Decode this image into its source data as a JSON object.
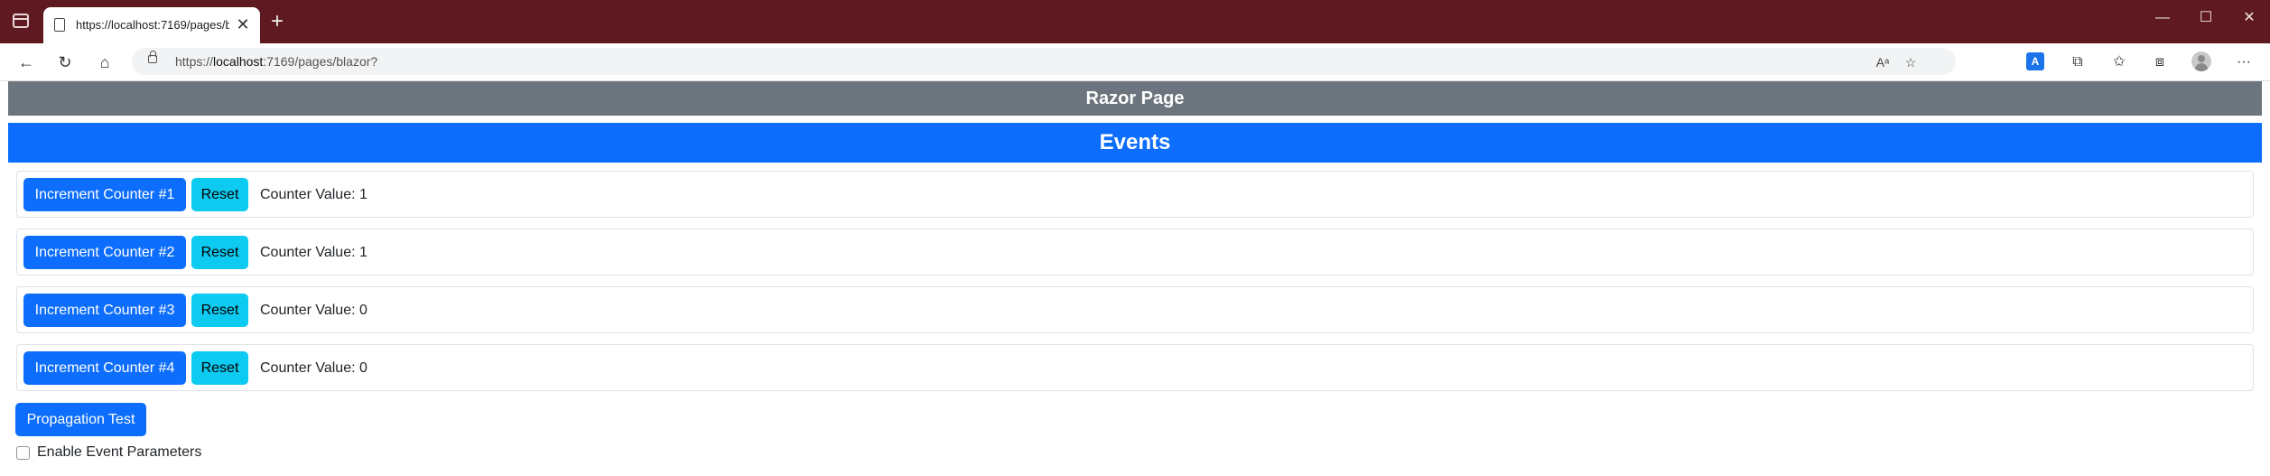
{
  "browser": {
    "tab_title": "https://localhost:7169/pages/blazor?",
    "tab_close_glyph": "✕",
    "new_tab_glyph": "+",
    "url_host_prefix": "https://",
    "url_host": "localhost",
    "url_rest": ":7169/pages/blazor?",
    "window_controls": {
      "minimize": "—",
      "maximize": "☐",
      "close": "✕"
    },
    "nav_glyphs": {
      "back": "←",
      "refresh": "↻",
      "home": "⌂"
    },
    "toolbar_glyphs": {
      "read_aloud": "Aᵃ",
      "favorite": "☆",
      "translate": "A",
      "extensions": "⧉",
      "favorites_bar": "✩",
      "collections": "⧈",
      "more": "···"
    },
    "colors": {
      "title_bar": "#5e1a20",
      "primary": "#0d6efd",
      "info": "#0dcaf0",
      "secondary": "#6c757d"
    }
  },
  "page": {
    "header": "Razor Page",
    "section_title": "Events",
    "counters": [
      {
        "button": "Increment Counter #1",
        "reset": "Reset",
        "value_text": "Counter Value: 1"
      },
      {
        "button": "Increment Counter #2",
        "reset": "Reset",
        "value_text": "Counter Value: 1"
      },
      {
        "button": "Increment Counter #3",
        "reset": "Reset",
        "value_text": "Counter Value: 0"
      },
      {
        "button": "Increment Counter #4",
        "reset": "Reset",
        "value_text": "Counter Value: 0"
      }
    ],
    "propagation_button": "Propagation Test",
    "event_params_label": "Enable Event Parameters",
    "event_params_checked": false
  }
}
